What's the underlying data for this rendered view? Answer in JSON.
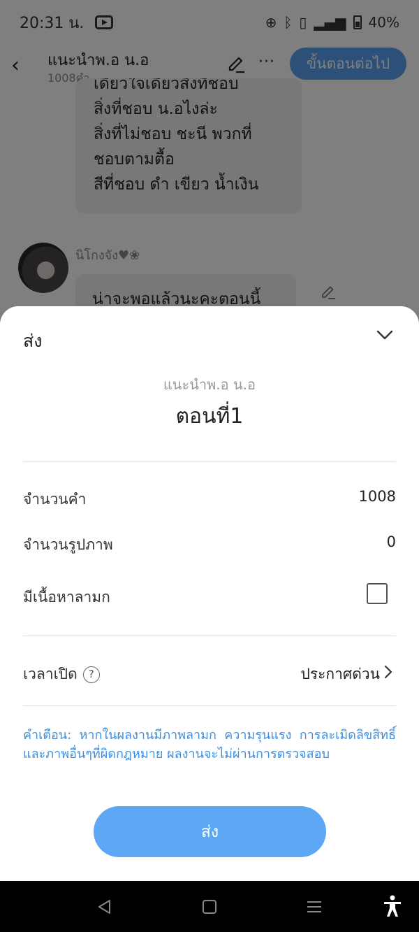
{
  "status_bar": {
    "time": "20:31 น.",
    "network": "ⁱᵗᴱ",
    "battery": "40%"
  },
  "top_bar": {
    "title": "แนะนำพ.อ น.อ",
    "subtitle": "1008คำ",
    "next_label": "ขั้นตอนต่อไป"
  },
  "chat": {
    "lines": [
      "เดี๋ยวใจเดียวสิ่งที่ชอบ",
      "สิ่งที่ชอบ น.อไงล่ะ",
      "สิ่งที่ไม่ชอบ ชะนี พวกที่",
      "ชอบตามตื้อ",
      "สีที่ชอบ ดำ  เขียว น้ำเงิน"
    ],
    "username": "นิโกงจัง♥❀",
    "second_message": "น่าจะพอแล้วนะคะตอนนี้"
  },
  "sheet": {
    "title": "ส่ง",
    "story_name": "แนะนำพ.อ น.อ",
    "chapter": "ตอนที่1",
    "word_count_label": "จำนวนคำ",
    "word_count_value": "1008",
    "image_count_label": "จำนวนรูปภาพ",
    "image_count_value": "0",
    "mature_label": "มีเนื้อหาลามก",
    "mature_checked": false,
    "publish_time_label": "เวลาเปิด",
    "help_glyph": "?",
    "publish_time_value": "ประกาศด่วน",
    "warning": "คำเตือน: หากในผลงานมีภาพลามก ความรุนแรง การละเมิดลิขสิทธิ์และภาพอื่นๆที่ผิดกฎหมาย ผลงานจะไม่ผ่านการตรวจสอบ",
    "submit_label": "ส่ง"
  },
  "colors": {
    "accent": "#5ea7f5",
    "warning_text": "#3d8fe0"
  }
}
